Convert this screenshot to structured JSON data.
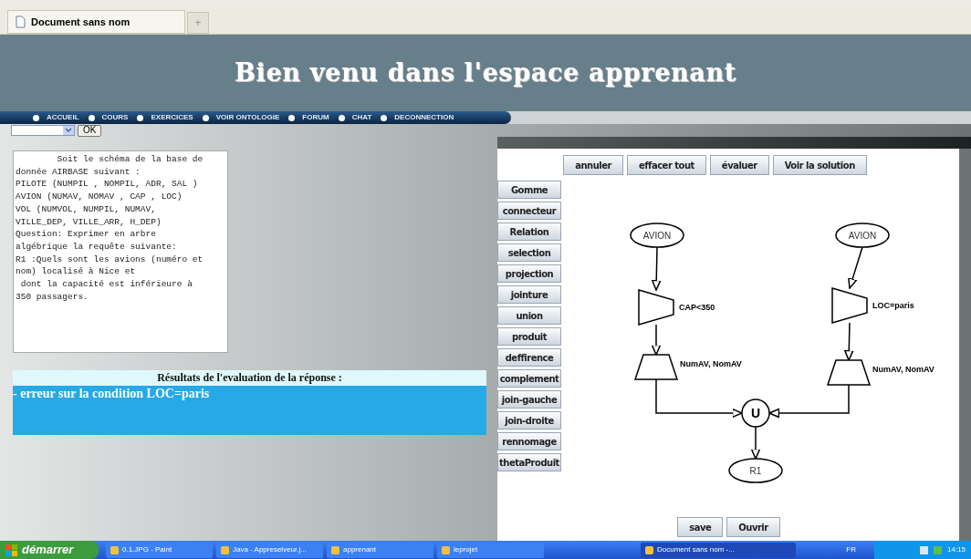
{
  "browser": {
    "tabs": [
      {
        "label": "Document sans nom",
        "selected": true
      }
    ],
    "new_tab": "+"
  },
  "banner": {
    "title": "Bien venu dans l'espace apprenant"
  },
  "nav": [
    "ACCUEIL",
    "COURS",
    "EXERCICES",
    "VOIR ONTOLOGIE",
    "FORUM",
    "CHAT",
    "DECONNECTION"
  ],
  "selector": {
    "button": "OK"
  },
  "exercise": {
    "text": "        Soit le schéma de la base de\ndonnée AIRBASE suivant :\nPILOTE (NUMPIL , NOMPIL, ADR, SAL )\nAVION (NUMAV, NOMAV , CAP , LOC)\nVOL (NUMVOL, NUMPIL, NUMAV,\nVILLE_DEP, VILLE_ARR, H_DEP)\nQuestion: Exprimer en arbre\nalgébrique la requête suivante:\nR1 :Quels sont les avions (numéro et\nnom) localisé à Nice et\n dont la capacité est inférieure à\n350 passagers."
  },
  "results": {
    "title": "Résultats de l'evaluation de la réponse :",
    "message": "- erreur sur la condition LOC=paris"
  },
  "applet": {
    "actions": [
      "annuler",
      "effacer tout",
      "évaluer",
      "Voir la solution"
    ],
    "tools": [
      "Gomme",
      "connecteur",
      "Relation",
      "selection",
      "projection",
      "jointure",
      "union",
      "produit",
      "deffirence",
      "complement",
      "join-gauche",
      "join-droite",
      "rennomage",
      "thetaProduit"
    ],
    "diagram": [
      {
        "kind": "relation",
        "label": "AVION"
      },
      {
        "kind": "relation",
        "label": "AVION"
      },
      {
        "kind": "selection",
        "label": "CAP<350"
      },
      {
        "kind": "selection",
        "label": "LOC=paris"
      },
      {
        "kind": "projection",
        "label": "NumAV, NomAV"
      },
      {
        "kind": "projection",
        "label": "NumAV, NomAV"
      },
      {
        "kind": "union",
        "label": "U"
      },
      {
        "kind": "relation",
        "label": "R1"
      }
    ],
    "bottom_buttons": [
      "save",
      "Ouvrir"
    ]
  },
  "taskbar": {
    "start": "démarrer",
    "items": [
      {
        "label": "0.1.JPG - Paint",
        "selected": false
      },
      {
        "label": "Java - Appreselveur.j...",
        "selected": false
      },
      {
        "label": "apprenant",
        "selected": false
      },
      {
        "label": "leprojet",
        "selected": false
      },
      {
        "label": "Document sans nom -...",
        "selected": true
      }
    ],
    "language": "FR",
    "clock": "14:15"
  }
}
